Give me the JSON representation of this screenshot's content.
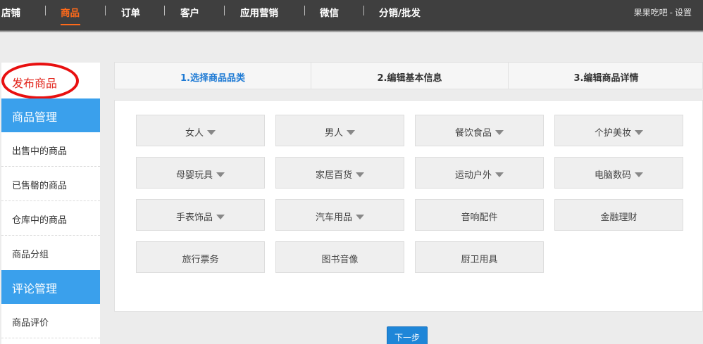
{
  "topnav": {
    "items": [
      "店铺",
      "商品",
      "订单",
      "客户",
      "应用营销",
      "微信",
      "分销/批发"
    ],
    "active_index": 1,
    "user_name": "果果吃吧",
    "settings_label": "设置",
    "separator": "-"
  },
  "sidebar": {
    "publish_label": "发布商品",
    "groups": [
      {
        "label": "商品管理",
        "items": [
          "出售中的商品",
          "已售罄的商品",
          "仓库中的商品",
          "商品分组"
        ]
      },
      {
        "label": "评论管理",
        "items": [
          "商品评价"
        ]
      }
    ]
  },
  "steps": [
    "1.选择商品品类",
    "2.编辑基本信息",
    "3.编辑商品详情"
  ],
  "active_step": 0,
  "categories": [
    {
      "label": "女人",
      "has_dropdown": true
    },
    {
      "label": "男人",
      "has_dropdown": true
    },
    {
      "label": "餐饮食品",
      "has_dropdown": true
    },
    {
      "label": "个护美妆",
      "has_dropdown": true
    },
    {
      "label": "母婴玩具",
      "has_dropdown": true
    },
    {
      "label": "家居百货",
      "has_dropdown": true
    },
    {
      "label": "运动户外",
      "has_dropdown": true
    },
    {
      "label": "电脑数码",
      "has_dropdown": true
    },
    {
      "label": "手表饰品",
      "has_dropdown": true
    },
    {
      "label": "汽车用品",
      "has_dropdown": true
    },
    {
      "label": "音响配件",
      "has_dropdown": false
    },
    {
      "label": "金融理财",
      "has_dropdown": false
    },
    {
      "label": "旅行票务",
      "has_dropdown": false
    },
    {
      "label": "图书音像",
      "has_dropdown": false
    },
    {
      "label": "厨卫用具",
      "has_dropdown": false
    }
  ],
  "next_button_label": "下一步",
  "colors": {
    "topbar": "#3f3f3f",
    "nav_active": "#ff6a1a",
    "sidebar_group": "#3aa0ec",
    "step_active": "#1e7ad4",
    "next_button": "#1e86d8",
    "highlight_circle": "#e81010"
  }
}
